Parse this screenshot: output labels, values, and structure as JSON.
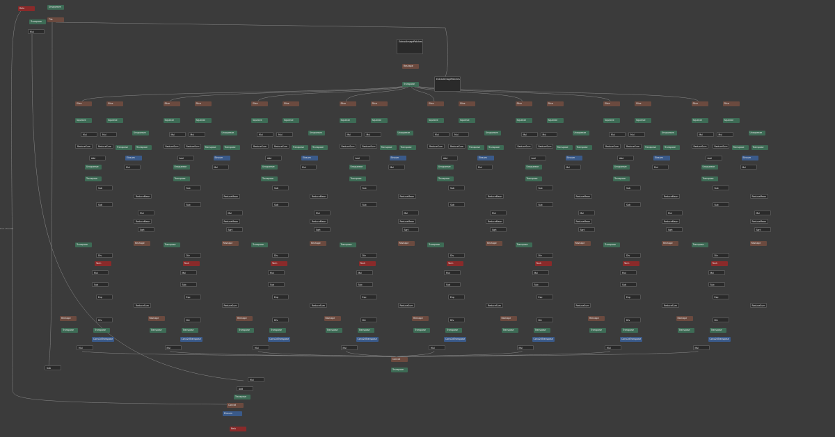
{
  "colors": {
    "background": "#3b3b3b",
    "transpose": "#3d6b55",
    "operator": "#2a2a2a",
    "slice": "#6b4a3f",
    "tanh": "#8a2a2a",
    "einsum": "#3a5a8a",
    "edge": "#8c8c8c"
  },
  "top": {
    "relu": "Relu",
    "unsqueeze": "Unsqueeze",
    "tile": "Tile",
    "transpose": "Transpose",
    "mul": "Mul",
    "side_label": "8×4×56×64"
  },
  "patches": {
    "extract1": "ExtractImagePatches",
    "reshape1": "Reshape",
    "extract2": "ExtractImagePatches",
    "transpose": "Transpose"
  },
  "branch_labels": [
    "Slice",
    "Slice",
    "Squeeze",
    "Squeeze",
    "Mul",
    "Mul",
    "Unsqueeze",
    "ReduceSum",
    "ReduceSum",
    "Transpose",
    "Transpose",
    "Add",
    "Einsum",
    "Unsqueeze",
    "Mul",
    "Transpose",
    "Sub",
    "ReduceMean",
    "Sub",
    "Mul",
    "ReduceMean",
    "Sqrt",
    "Transpose",
    "Reshape",
    "Div",
    "Tanh",
    "Mul",
    "Sub",
    "Exp",
    "ReduceSum",
    "Reshape",
    "Div",
    "Transpose",
    "Transpose",
    "Conv2dTranspose",
    "Mul"
  ],
  "columns": 8,
  "bottom": {
    "concat": "Concat",
    "transpose": "Transpose",
    "sub": "Sub",
    "mul": "Mul",
    "add": "Add",
    "transpose2": "Transpose",
    "concat2": "Concat",
    "einsum": "Einsum",
    "relu": "Relu"
  }
}
